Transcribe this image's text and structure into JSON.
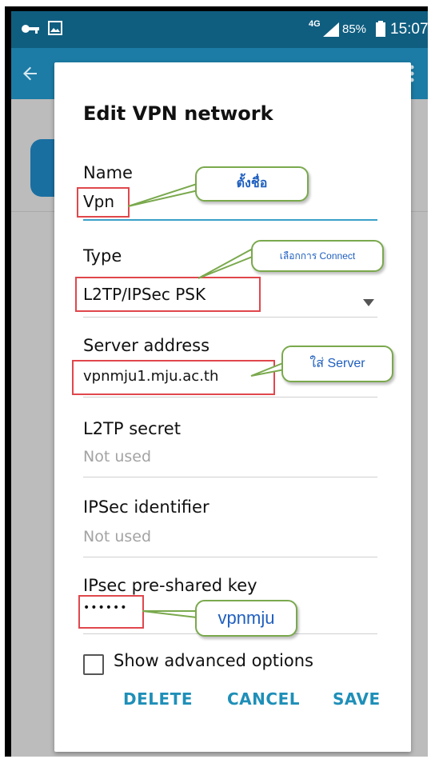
{
  "status_bar": {
    "network": "4G",
    "battery": "85%",
    "time": "15:07"
  },
  "dialog": {
    "title": "Edit VPN network",
    "fields": {
      "name": {
        "label": "Name",
        "value": "Vpn"
      },
      "type": {
        "label": "Type",
        "value": "L2TP/IPSec PSK"
      },
      "server": {
        "label": "Server address",
        "value": "vpnmju1.mju.ac.th"
      },
      "l2tp_secret": {
        "label": "L2TP secret",
        "placeholder": "Not used"
      },
      "ipsec_identifier": {
        "label": "IPSec identifier",
        "placeholder": "Not used"
      },
      "psk": {
        "label": "IPsec pre-shared key",
        "value": "••••••"
      }
    },
    "show_advanced": {
      "label": "Show advanced options",
      "checked": false
    },
    "buttons": {
      "delete": "DELETE",
      "cancel": "CANCEL",
      "save": "SAVE"
    }
  },
  "annotations": {
    "name_note": "ตั้งชื่อ",
    "type_note": "เลือกการ Connect",
    "server_note": "ใส่ Server",
    "psk_note": "vpnmju"
  },
  "colors": {
    "status_bar": "#0f5e80",
    "app_bar": "#1c7ca6",
    "accent": "#1f8fb8",
    "highlight_box": "#e0474c",
    "callout_border": "#7aa94d",
    "callout_text": "#1f5fbf"
  }
}
